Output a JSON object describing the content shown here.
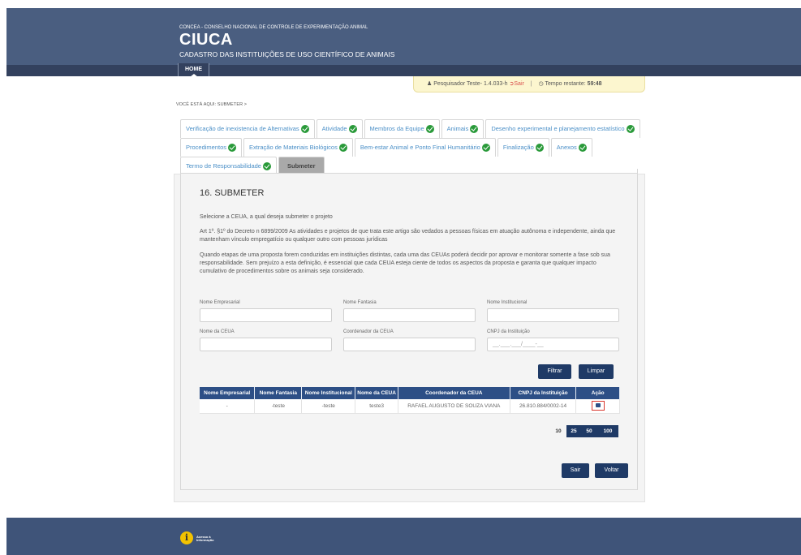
{
  "header": {
    "org": "CONCEA - CONSELHO NACIONAL DE CONTROLE DE EXPERIMENTAÇÃO ANIMAL",
    "brand": "CIUCA",
    "subtitle": "CADASTRO DAS INSTITUIÇÕES DE USO CIENTÍFICO DE ANIMAIS"
  },
  "nav": {
    "home": "HOME"
  },
  "userbar": {
    "user": "Pesquisador Teste- 1.4.033-h",
    "logout": "Sair",
    "separator": "|",
    "timer_label": "Tempo restante:",
    "timer_value": "59:48"
  },
  "breadcrumb": "VOCÊ ESTÁ AQUI: SUBMETER >",
  "tabs": {
    "row1": [
      "Verificação de inexistencia de Alternativas",
      "Atividade",
      "Membros da Equipe",
      "Animais",
      "Desenho experimental e planejamento estatístico"
    ],
    "row2": [
      "Procedimentos",
      "Extração de Materiais Biológicos",
      "Bem-estar Animal e Ponto Final Humanitário",
      "Finalização",
      "Anexos"
    ],
    "row3": [
      "Termo de Responsabilidade",
      "Submeter"
    ]
  },
  "section": {
    "title": "16. SUBMETER",
    "intro": "Selecione a CEUA, a qual deseja submeter o projeto",
    "para1": "Art 1º. §1º do Decreto n 6899/2009 As atividades e projetos de que trata este artigo são vedados a pessoas físicas em atuação autônoma e independente, ainda que mantenham vínculo empregatício ou qualquer outro com pessoas jurídicas",
    "para2": "Quando etapas de uma proposta forem conduzidas em instituições distintas, cada uma das CEUAs poderá decidir por aprovar e monitorar somente a fase sob sua responsabilidade. Sem prejuízo a esta definição, é essencial que cada CEUA esteja ciente de todos os aspectos da proposta e garanta que qualquer impacto cumulativo de procedimentos sobre os animais seja considerado."
  },
  "filters": {
    "nome_empresarial": {
      "label": "Nome Empresarial",
      "value": ""
    },
    "nome_fantasia": {
      "label": "Nome Fantasia",
      "value": ""
    },
    "nome_institucional": {
      "label": "Nome Institucional",
      "value": ""
    },
    "nome_ceua": {
      "label": "Nome da CEUA",
      "value": ""
    },
    "coordenador_ceua": {
      "label": "Coordenador da CEUA",
      "value": ""
    },
    "cnpj": {
      "label": "CNPJ da Instituição",
      "placeholder": "__.___.___/____-__"
    },
    "filtrar": "Filtrar",
    "limpar": "Limpar"
  },
  "table": {
    "headers": [
      "Nome Empresarial",
      "Nome Fantasia",
      "Nome Institucional",
      "Nome da CEUA",
      "Coordenador da CEUA",
      "CNPJ da Instituição",
      "Ação"
    ],
    "rows": [
      [
        "-",
        "-teste",
        "-teste",
        "teste3",
        "RAFAEL AUGUSTO DE SOUZA VIANA",
        "26.810.884/0002-14"
      ]
    ]
  },
  "pager": [
    "10",
    "25",
    "50",
    "100"
  ],
  "actions": {
    "sair": "Sair",
    "voltar": "Voltar"
  },
  "footer": {
    "logo_letter": "i",
    "logo_line1": "Acesso à",
    "logo_line2": "Informação"
  },
  "colors": {
    "header": "#4a5e80",
    "navbar": "#33415e",
    "primary_button": "#1f3a66",
    "table_header": "#2d4f86",
    "check": "#2a9a3a",
    "highlight": "#d9382f"
  }
}
